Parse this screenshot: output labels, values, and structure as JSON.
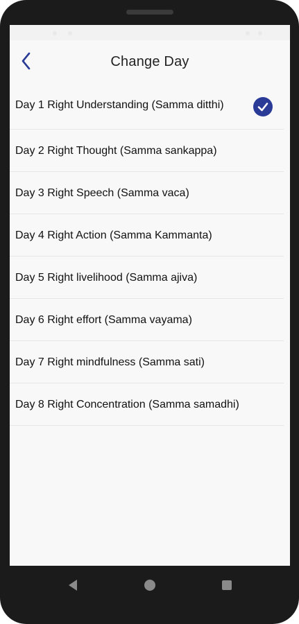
{
  "header": {
    "title": "Change Day"
  },
  "days": [
    {
      "label": "Day 1 Right Understanding (Samma ditthi)",
      "selected": true
    },
    {
      "label": "Day 2 Right Thought (Samma sankappa)",
      "selected": false
    },
    {
      "label": "Day 3 Right Speech (Samma vaca)",
      "selected": false
    },
    {
      "label": "Day 4 Right Action (Samma Kammanta)",
      "selected": false
    },
    {
      "label": "Day 5 Right livelihood (Samma ajiva)",
      "selected": false
    },
    {
      "label": "Day 6 Right effort (Samma vayama)",
      "selected": false
    },
    {
      "label": "Day 7 Right mindfulness (Samma sati)",
      "selected": false
    },
    {
      "label": "Day 8 Right Concentration (Samma samadhi)",
      "selected": false
    }
  ],
  "colors": {
    "accent": "#2a3b97",
    "back_icon": "#2a3b97",
    "nav_icons": "#8a8a8a"
  },
  "icons": {
    "back": "chevron-left-icon",
    "selected": "check-circle-icon",
    "nav_back": "triangle-back-icon",
    "nav_home": "circle-home-icon",
    "nav_recents": "square-recents-icon"
  }
}
